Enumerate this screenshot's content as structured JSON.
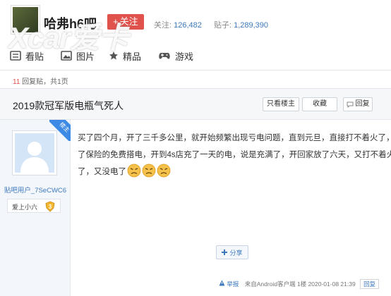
{
  "header": {
    "forum_title": "哈弗h6吧",
    "follow_label": "关注",
    "follow_plus": "+",
    "watermark": "Xcar爱卡",
    "followers_label": "关注:",
    "followers_count": "126,482",
    "posts_label": "贴子:",
    "posts_count": "1,289,390"
  },
  "tabs": [
    {
      "label": "看贴",
      "icon": "reading-icon"
    },
    {
      "label": "图片",
      "icon": "image-icon"
    },
    {
      "label": "精品",
      "icon": "star-icon"
    },
    {
      "label": "游戏",
      "icon": "gamepad-icon"
    }
  ],
  "reply_bar": {
    "count": "11",
    "text": " 回复贴，共1页"
  },
  "post": {
    "title": "2019款冠军版电瓶气死人",
    "buttons": {
      "only_op": "只看楼主",
      "favorite": "收藏",
      "reply": "回复"
    },
    "author": {
      "tag": "楼主",
      "username": "贴吧用户_7SeCWC6",
      "level_name": "爱上小六",
      "level_num": "3"
    },
    "content_lines": [
      "买了四个月，开了三千多公里，就开始频繁出现亏电问题，直到元旦，直接打不着火了，叫",
      "了保险的免费搭电，开到4s店充了一天的电，说是充满了，开回家放了六天，又打不着火",
      "了，又没电了"
    ],
    "share_label": "分享",
    "footer": {
      "report": "举报",
      "client": "来自Android客户端",
      "floor": "1楼",
      "time": "2020-01-08 21:39",
      "reply": "回复"
    }
  },
  "colors": {
    "accent_blue": "#3d78bd",
    "follow_red": "#e0524c",
    "tag_blue": "#3d8ae6"
  }
}
